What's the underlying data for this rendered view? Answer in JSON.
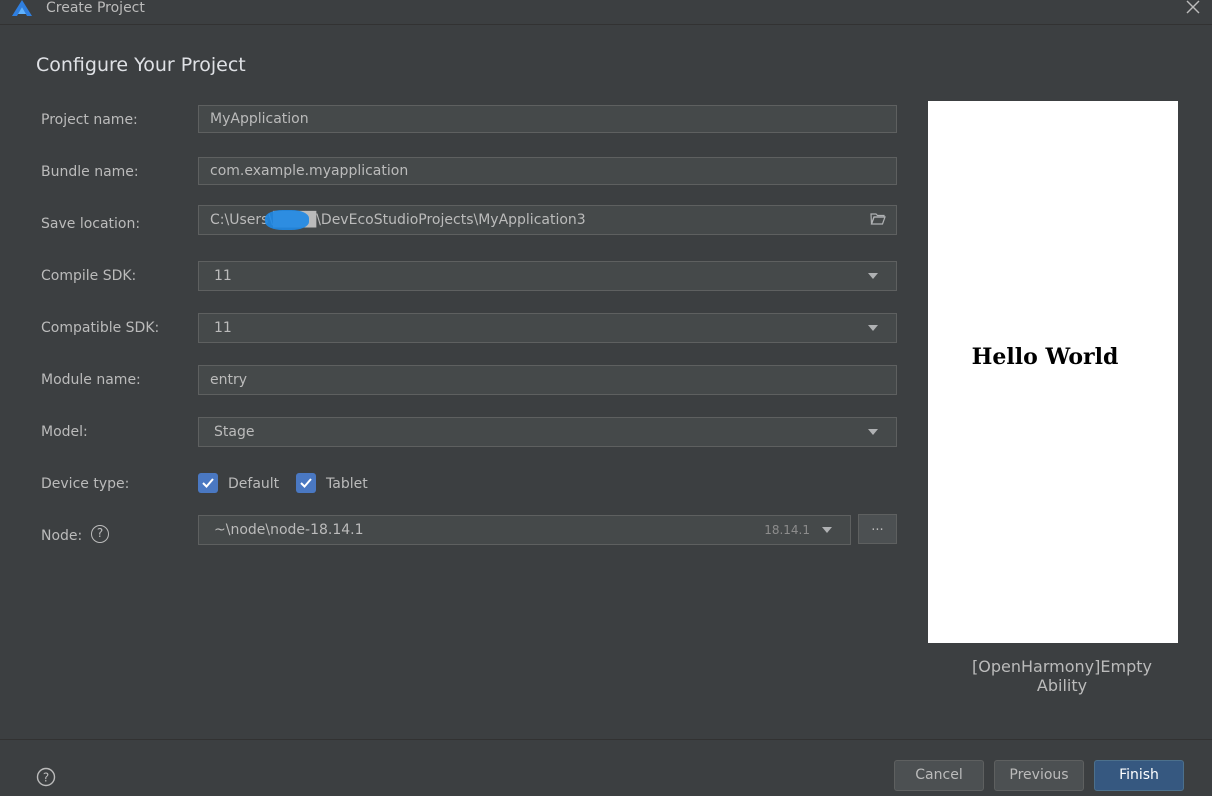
{
  "window": {
    "title": "Create Project"
  },
  "page": {
    "heading": "Configure Your Project"
  },
  "form": {
    "project_name": {
      "label": "Project name:",
      "value": "MyApplication"
    },
    "bundle_name": {
      "label": "Bundle name:",
      "value": "com.example.myapplication"
    },
    "save_location": {
      "label": "Save location:",
      "value": "C:\\Users\\████\\DevEcoStudioProjects\\MyApplication3"
    },
    "compile_sdk": {
      "label": "Compile SDK:",
      "value": "11"
    },
    "compatible_sdk": {
      "label": "Compatible SDK:",
      "value": "11"
    },
    "module_name": {
      "label": "Module name:",
      "value": "entry"
    },
    "model": {
      "label": "Model:",
      "value": "Stage"
    },
    "device_type": {
      "label": "Device type:",
      "options": [
        {
          "label": "Default",
          "checked": true
        },
        {
          "label": "Tablet",
          "checked": true
        }
      ]
    },
    "node": {
      "label": "Node:",
      "path": "~\\node\\node-18.14.1",
      "version": "18.14.1",
      "browse_label": "..."
    }
  },
  "preview": {
    "text": "Hello World",
    "template_name": "[OpenHarmony]Empty Ability"
  },
  "footer": {
    "cancel": "Cancel",
    "previous": "Previous",
    "finish": "Finish"
  },
  "colors": {
    "accent": "#4a78c2",
    "primary_button": "#365880",
    "background": "#3c3f41",
    "field": "#45494a"
  }
}
